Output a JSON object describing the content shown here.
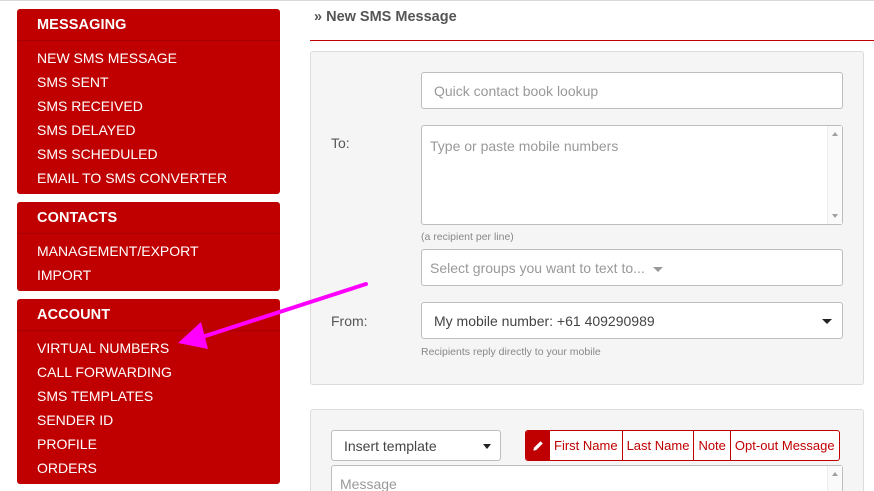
{
  "sidebar": {
    "messaging": {
      "header": "MESSAGING",
      "items": [
        {
          "label": "NEW SMS MESSAGE"
        },
        {
          "label": "SMS SENT"
        },
        {
          "label": "SMS RECEIVED"
        },
        {
          "label": "SMS DELAYED"
        },
        {
          "label": "SMS SCHEDULED"
        },
        {
          "label": "EMAIL TO SMS CONVERTER"
        }
      ]
    },
    "contacts": {
      "header": "CONTACTS",
      "items": [
        {
          "label": "MANAGEMENT/EXPORT"
        },
        {
          "label": "IMPORT"
        }
      ]
    },
    "account": {
      "header": "ACCOUNT",
      "items": [
        {
          "label": "VIRTUAL NUMBERS"
        },
        {
          "label": "CALL FORWARDING"
        },
        {
          "label": "SMS TEMPLATES"
        },
        {
          "label": "SENDER ID"
        },
        {
          "label": "PROFILE"
        },
        {
          "label": "ORDERS"
        }
      ]
    }
  },
  "page": {
    "title": "» New SMS Message"
  },
  "recipients": {
    "to_label": "To:",
    "lookup_placeholder": "Quick contact book lookup",
    "numbers_placeholder": "Type or paste mobile numbers",
    "numbers_hint": "(a recipient per line)",
    "groups_placeholder": "Select groups you want to text to...",
    "from_label": "From:",
    "from_value": "My mobile number: +61 409290989",
    "from_hint": "Recipients reply directly to your mobile"
  },
  "message": {
    "template_select": "Insert template",
    "merge_fields": [
      "First Name",
      "Last Name",
      "Note",
      "Opt-out Message"
    ],
    "message_placeholder": "Message"
  },
  "colors": {
    "brand_red": "#c00000",
    "annotation_arrow": "#ff00ff"
  }
}
